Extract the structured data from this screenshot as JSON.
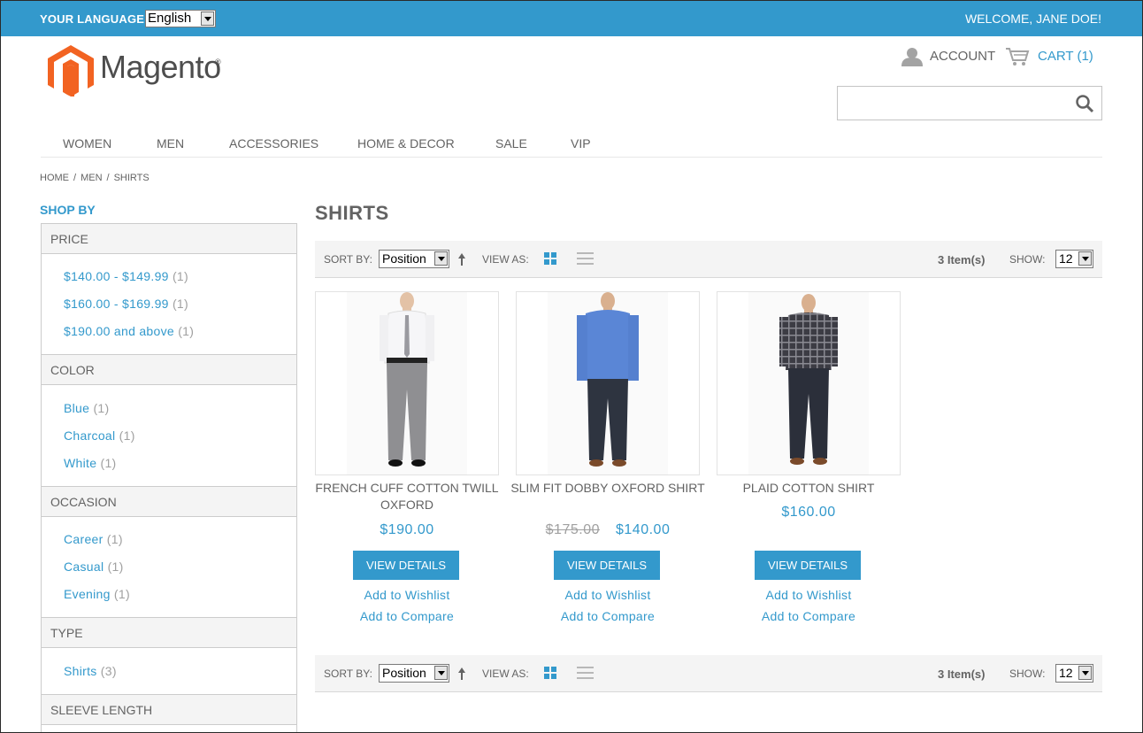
{
  "topbar": {
    "language_label": "YOUR LANGUAGE:",
    "language_value": "English",
    "welcome": "WELCOME, JANE DOE!"
  },
  "header": {
    "logo_text": "Magento",
    "logo_mark": "®",
    "account_label": "ACCOUNT",
    "cart_label": "CART (1)",
    "search_value": "",
    "icons": {
      "account": "user-icon",
      "cart": "cart-icon",
      "search": "search-icon"
    }
  },
  "nav": {
    "items": [
      "WOMEN",
      "MEN",
      "ACCESSORIES",
      "HOME & DECOR",
      "SALE",
      "VIP"
    ]
  },
  "breadcrumb": {
    "items": [
      "HOME",
      "MEN",
      "SHIRTS"
    ],
    "separator": "/"
  },
  "sidebar": {
    "title": "SHOP BY",
    "filters": [
      {
        "name": "PRICE",
        "options": [
          {
            "label": "$140.00 - $149.99",
            "count": "(1)"
          },
          {
            "label": "$160.00 - $169.99",
            "count": "(1)"
          },
          {
            "label": "$190.00 and above",
            "count": "(1)"
          }
        ]
      },
      {
        "name": "COLOR",
        "options": [
          {
            "label": "Blue",
            "count": "(1)"
          },
          {
            "label": "Charcoal",
            "count": "(1)"
          },
          {
            "label": "White",
            "count": "(1)"
          }
        ]
      },
      {
        "name": "OCCASION",
        "options": [
          {
            "label": "Career",
            "count": "(1)"
          },
          {
            "label": "Casual",
            "count": "(1)"
          },
          {
            "label": "Evening",
            "count": "(1)"
          }
        ]
      },
      {
        "name": "TYPE",
        "options": [
          {
            "label": "Shirts",
            "count": "(3)"
          }
        ]
      },
      {
        "name": "SLEEVE LENGTH",
        "options": []
      }
    ]
  },
  "main": {
    "title": "SHIRTS",
    "toolbar": {
      "sort_label": "SORT BY:",
      "sort_value": "Position",
      "view_label": "VIEW AS:",
      "items_count": "3 Item(s)",
      "show_label": "SHOW:",
      "show_value": "12"
    },
    "products": [
      {
        "name": "FRENCH CUFF COTTON TWILL OXFORD",
        "old_price": "",
        "price": "$190.00",
        "button": "VIEW DETAILS",
        "wishlist": "Add to Wishlist",
        "compare": "Add to Compare",
        "shirt_color": "#f6f6f8",
        "pants_color": "#8f8f92"
      },
      {
        "name": "SLIM FIT DOBBY OXFORD SHIRT",
        "old_price": "$175.00",
        "price": "$140.00",
        "button": "VIEW DETAILS",
        "wishlist": "Add to Wishlist",
        "compare": "Add to Compare",
        "shirt_color": "#5a86d6",
        "pants_color": "#2e3440"
      },
      {
        "name": "PLAID COTTON SHIRT",
        "old_price": "",
        "price": "$160.00",
        "button": "VIEW DETAILS",
        "wishlist": "Add to Wishlist",
        "compare": "Add to Compare",
        "shirt_color": "#3c3c44",
        "pants_color": "#2b2f3a"
      }
    ]
  },
  "colors": {
    "accent": "#3399cc",
    "text": "#636363",
    "panel": "#f4f4f4"
  }
}
